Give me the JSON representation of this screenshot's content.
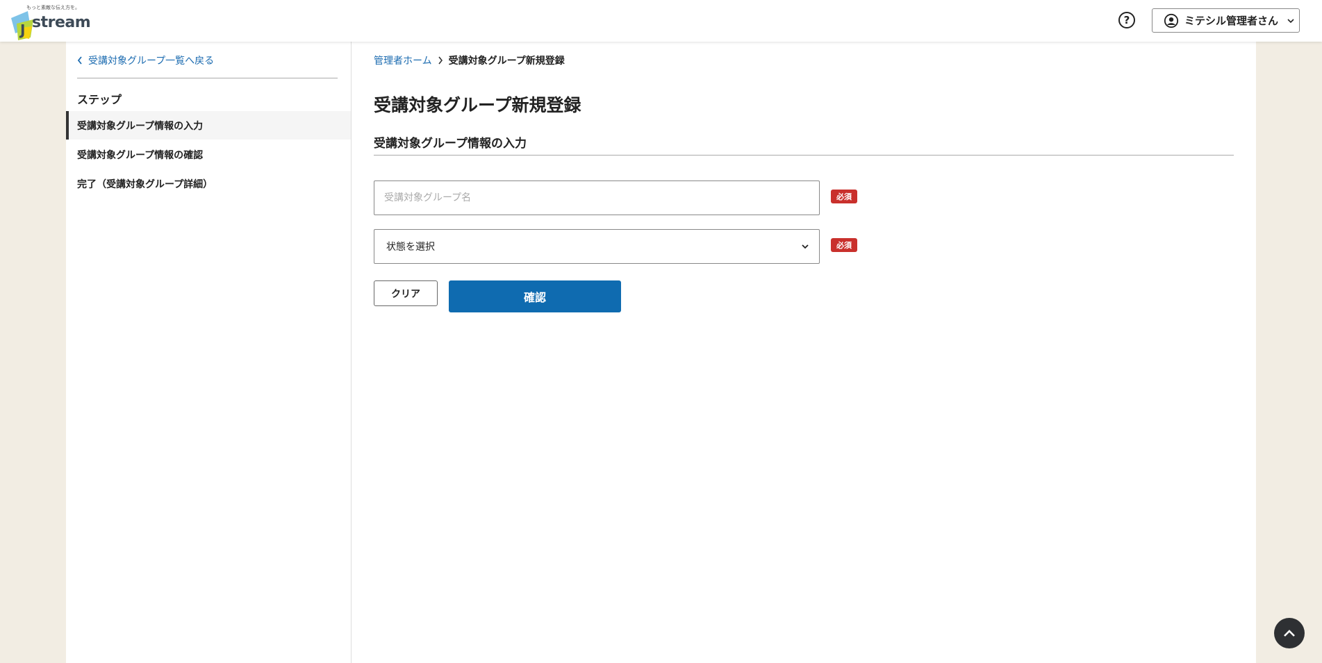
{
  "header": {
    "logo_tagline": "もっと素敵な伝え方を。",
    "logo_text": "stream",
    "help_icon": "question-circle-icon",
    "user_menu": {
      "name": "ミテシル管理者さん",
      "icon": "user-circle-icon",
      "chevron": "chevron-down-icon"
    }
  },
  "sidebar": {
    "back_link": "受講対象グループ一覧へ戻る",
    "steps_heading": "ステップ",
    "steps": [
      {
        "label": "受講対象グループ情報の入力",
        "active": true
      },
      {
        "label": "受講対象グループ情報の確認",
        "active": false
      },
      {
        "label": "完了（受講対象グループ詳細）",
        "active": false
      }
    ]
  },
  "breadcrumb": {
    "home": "管理者ホーム",
    "current": "受講対象グループ新規登録"
  },
  "main": {
    "title": "受講対象グループ新規登録",
    "section_title": "受講対象グループ情報の入力",
    "form": {
      "group_name": {
        "placeholder": "受講対象グループ名",
        "value": "",
        "required_label": "必須"
      },
      "status": {
        "value": "状態を選択",
        "required_label": "必須"
      }
    },
    "buttons": {
      "clear": "クリア",
      "confirm": "確認"
    }
  },
  "colors": {
    "accent": "#0f6bb0",
    "required": "#c9302c",
    "background": "#f2ede3"
  }
}
